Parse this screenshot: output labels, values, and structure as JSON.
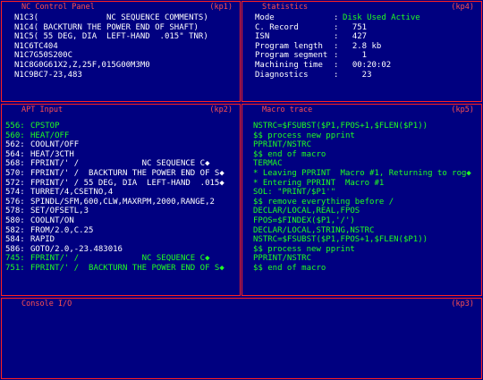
{
  "panels": {
    "nc_control": {
      "title": "NC Control Panel",
      "tag": "(kp1)",
      "lines": [
        "N1C3(              NC SEQUENCE COMMENTS)",
        "N1C4( BACKTURN THE POWER END OF SHAFT)",
        "N1C5( 55 DEG, DIA  LEFT-HAND  .015\" TNR)",
        "N1C6TC404",
        "N1C7G50S200C",
        "N1C8G0G61X2,Z,25F,015G00M3M0",
        "N1C9BC7-23,483"
      ]
    },
    "statistics": {
      "title": "Statistics",
      "tag": "(kp4)",
      "rows": [
        {
          "label": "Mode",
          "value": "Disk Used Active",
          "green": true
        },
        {
          "label": "C. Record",
          "value": "  751",
          "green": false
        },
        {
          "label": "ISN",
          "value": "  427",
          "green": false
        },
        {
          "label": "Program length",
          "value": "  2.8 kb",
          "green": false
        },
        {
          "label": "Program segment",
          "value": "    1",
          "green": false
        },
        {
          "label": "Machining time",
          "value": "  00:20:02",
          "green": false
        },
        {
          "label": "Diagnostics",
          "value": "    23",
          "green": false
        }
      ]
    },
    "apt_input": {
      "title": "APT Input",
      "tag": "(kp2)",
      "lines": [
        {
          "pos": "556:",
          "text": "CPSTOP",
          "green": true
        },
        {
          "pos": "560:",
          "text": "HEAT/OFF",
          "green": true
        },
        {
          "pos": "562:",
          "text": "COOLNT/OFF",
          "green": false
        },
        {
          "pos": "564:",
          "text": "HEAT/3CTH",
          "green": false
        },
        {
          "pos": "568:",
          "text": "FPRINT/' /             NC SEQUENCE C◆",
          "green": false
        },
        {
          "pos": "570:",
          "text": "FPRINT/' /  BACKTURN THE POWER END OF S◆",
          "green": false
        },
        {
          "pos": "572:",
          "text": "FPRINT/' / 55 DEG, DIA  LEFT-HAND  .015◆",
          "green": false
        },
        {
          "pos": "574:",
          "text": "TURRET/4,CSETNO,4",
          "green": false
        },
        {
          "pos": "576:",
          "text": "SPINDL/SFM,600,CLW,MAXRPM,2000,RANGE,2",
          "green": false
        },
        {
          "pos": "578:",
          "text": "SET/OFSETL,3",
          "green": false
        },
        {
          "pos": "580:",
          "text": "COOLNT/ON",
          "green": false
        },
        {
          "pos": "582:",
          "text": "FROM/2.0,C.25",
          "green": false
        },
        {
          "pos": "584:",
          "text": "RAPID",
          "green": false
        },
        {
          "pos": "586:",
          "text": "GOTO/2.0,-23.483016",
          "green": false
        },
        {
          "pos": "745:",
          "text": "FPRINT/' /             NC SEQUENCE C◆",
          "green": true
        },
        {
          "pos": "751:",
          "text": "FPRINT/' /  BACKTURN THE POWER END OF S◆",
          "green": true
        }
      ]
    },
    "macro_trace": {
      "title": "Macro trace",
      "tag": "(kp5)",
      "lines": [
        {
          "text": "NSTRC=$FSUBST($P1,FPOS+1,$FLEN($P1))",
          "green": true
        },
        {
          "text": "$$ process new pprint",
          "green": true
        },
        {
          "text": "PPRINT/NSTRC",
          "green": true
        },
        {
          "text": "$$ end of macro",
          "green": true
        },
        {
          "text": "TERMAC",
          "green": true
        },
        {
          "text": "* Leaving PPRINT  Macro #1, Returning to rog◆",
          "green": true
        },
        {
          "text": "* Entering PPRINT  Macro #1",
          "green": true
        },
        {
          "text": "SOL: \"PRINT/$P1'\"",
          "green": true
        },
        {
          "text": "$$ remove everything before /",
          "green": true
        },
        {
          "text": "DECLAR/LOCAL,REAL,FPOS",
          "green": true
        },
        {
          "text": "FPOS=$FINDEX($P1,'/')",
          "green": true
        },
        {
          "text": "DECLAR/LOCAL,STRING,NSTRC",
          "green": true
        },
        {
          "text": "NSTRC=$FSUBST($P1,FPOS+1,$FLEN($P1))",
          "green": true
        },
        {
          "text": "$$ process new pprint",
          "green": true
        },
        {
          "text": "PPRINT/NSTRC",
          "green": true
        },
        {
          "text": "$$ end of macro",
          "green": true
        }
      ]
    },
    "console": {
      "title": "Console I/O",
      "tag": "(kp3)"
    }
  }
}
